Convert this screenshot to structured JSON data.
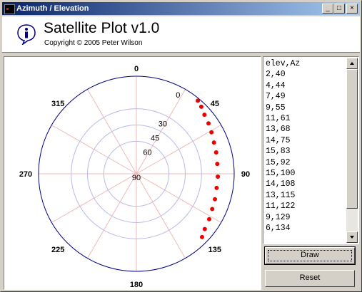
{
  "window": {
    "title": "Azimuth / Elevation"
  },
  "titlebar_buttons": {
    "minimize": "_",
    "maximize": "□",
    "close": "×"
  },
  "header": {
    "title": "Satellite Plot v1.0",
    "copyright": "Copyright © 2005 Peter Wilson"
  },
  "plot": {
    "azimuth_labels": [
      "0",
      "45",
      "90",
      "135",
      "180",
      "225",
      "270",
      "315"
    ],
    "elevation_labels": [
      "0",
      "30",
      "45",
      "60",
      "90"
    ],
    "points": [
      [
        2,
        40
      ],
      [
        4,
        44
      ],
      [
        7,
        49
      ],
      [
        9,
        55
      ],
      [
        11,
        61
      ],
      [
        13,
        68
      ],
      [
        14,
        75
      ],
      [
        15,
        83
      ],
      [
        15,
        92
      ],
      [
        15,
        100
      ],
      [
        14,
        108
      ],
      [
        13,
        115
      ],
      [
        11,
        122
      ],
      [
        9,
        129
      ],
      [
        6,
        134
      ]
    ],
    "colors": {
      "circle": "#000080",
      "inner": "#b8b8e8",
      "cross": "#f0b8b8",
      "point": "#ee0000"
    }
  },
  "list": {
    "items": [
      "elev,Az",
      "2,40",
      "4,44",
      "7,49",
      "9,55",
      "11,61",
      "13,68",
      "14,75",
      "15,83",
      "15,92",
      "15,100",
      "14,108",
      "13,115",
      "11,122",
      "9,129",
      "6,134"
    ]
  },
  "buttons": {
    "draw": "Draw",
    "reset": "Reset"
  }
}
